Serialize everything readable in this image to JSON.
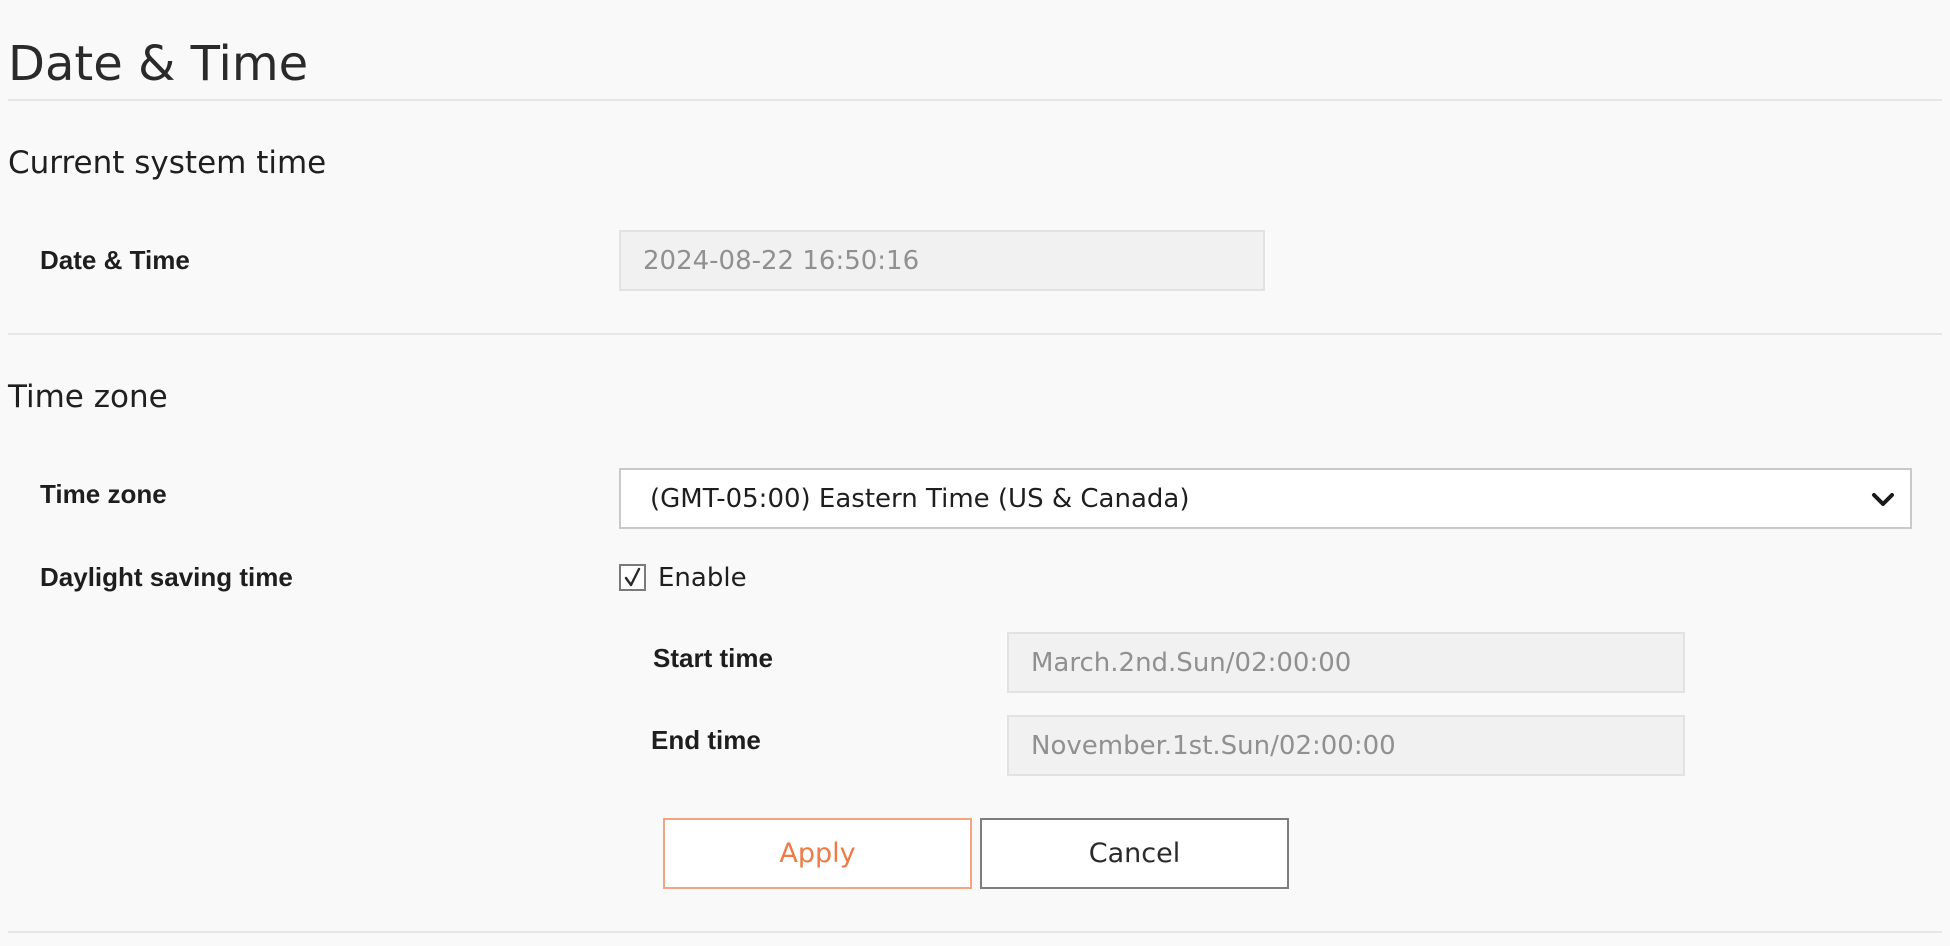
{
  "page": {
    "title": "Date & Time"
  },
  "current_time": {
    "section_title": "Current system time",
    "label": "Date & Time",
    "value": "2024-08-22 16:50:16"
  },
  "timezone": {
    "section_title": "Time zone",
    "label": "Time zone",
    "selected": "(GMT-05:00) Eastern Time (US & Canada)",
    "dst_label": "Daylight saving time",
    "dst_checkbox_label": "Enable",
    "dst_enabled": true,
    "start_label": "Start time",
    "start_value": "March.2nd.Sun/02:00:00",
    "end_label": "End time",
    "end_value": "November.1st.Sun/02:00:00"
  },
  "buttons": {
    "apply": "Apply",
    "cancel": "Cancel"
  },
  "colors": {
    "accent": "#f07a45",
    "background": "#f9f9f9"
  },
  "icons": {
    "select_arrow": "chevron-down-icon",
    "checkbox": "checkmark-icon"
  }
}
